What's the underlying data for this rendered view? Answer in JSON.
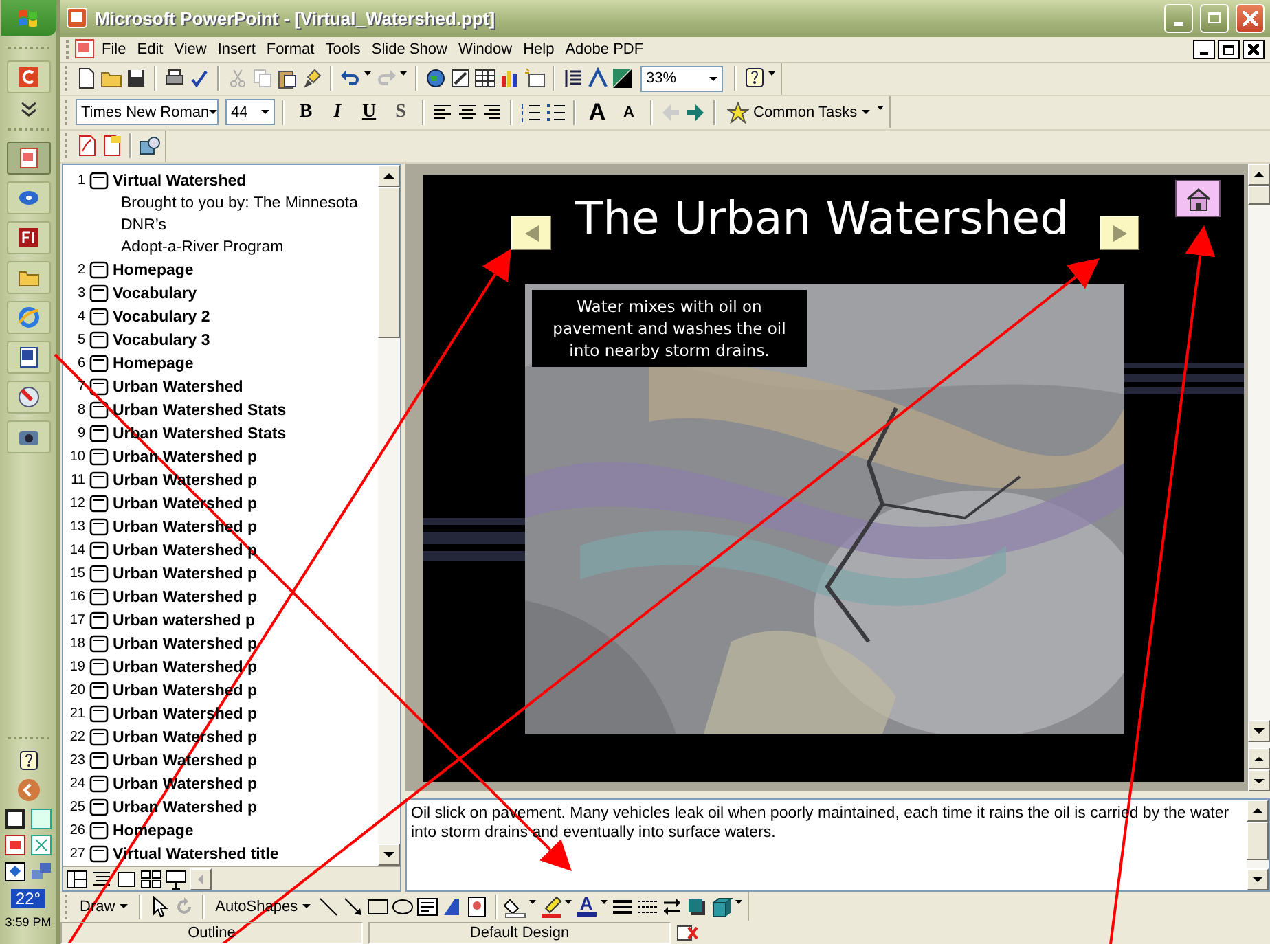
{
  "taskbar": {
    "weather": "22°",
    "clock": "3:59 PM"
  },
  "window": {
    "title": "Microsoft PowerPoint - [Virtual_Watershed.ppt]"
  },
  "menu": [
    "File",
    "Edit",
    "View",
    "Insert",
    "Format",
    "Tools",
    "Slide Show",
    "Window",
    "Help",
    "Adobe PDF"
  ],
  "standard_toolbar": {
    "zoom": "33%"
  },
  "formatting_toolbar": {
    "font": "Times New Roman",
    "size": "44",
    "style_buttons": [
      "B",
      "I",
      "U",
      "S"
    ],
    "size_buttons": [
      "A",
      "A"
    ],
    "common_tasks": "Common Tasks"
  },
  "outline": [
    {
      "number": "1",
      "title": "Virtual Watershed",
      "body": [
        "Brought to you by: The Minnesota",
        "DNR’s",
        "Adopt-a-River Program"
      ]
    },
    {
      "number": "2",
      "title": "Homepage"
    },
    {
      "number": "3",
      "title": "Vocabulary"
    },
    {
      "number": "4",
      "title": "Vocabulary 2"
    },
    {
      "number": "5",
      "title": "Vocabulary 3"
    },
    {
      "number": "6",
      "title": "Homepage"
    },
    {
      "number": "7",
      "title": "Urban Watershed"
    },
    {
      "number": "8",
      "title": "Urban Watershed Stats"
    },
    {
      "number": "9",
      "title": "Urban Watershed Stats"
    },
    {
      "number": "10",
      "title": "Urban Watershed p"
    },
    {
      "number": "11",
      "title": "Urban Watershed p"
    },
    {
      "number": "12",
      "title": "Urban Watershed p"
    },
    {
      "number": "13",
      "title": "Urban Watershed p"
    },
    {
      "number": "14",
      "title": "Urban Watershed p"
    },
    {
      "number": "15",
      "title": "Urban Watershed p"
    },
    {
      "number": "16",
      "title": "Urban Watershed p"
    },
    {
      "number": "17",
      "title": "Urban watershed p"
    },
    {
      "number": "18",
      "title": "Urban Watershed p"
    },
    {
      "number": "19",
      "title": "Urban Watershed p"
    },
    {
      "number": "20",
      "title": "Urban Watershed p"
    },
    {
      "number": "21",
      "title": "Urban Watershed p"
    },
    {
      "number": "22",
      "title": "Urban Watershed p"
    },
    {
      "number": "23",
      "title": "Urban Watershed p"
    },
    {
      "number": "24",
      "title": "Urban Watershed p"
    },
    {
      "number": "25",
      "title": "Urban Watershed p"
    },
    {
      "number": "26",
      "title": "Homepage"
    },
    {
      "number": "27",
      "title": "Virtual Watershed title"
    }
  ],
  "slide": {
    "title": "The Urban Watershed",
    "caption": "Water mixes with oil on pavement and washes the oil into nearby storm drains."
  },
  "notes": "Oil slick on pavement. Many vehicles leak oil when poorly maintained, each time it rains the oil is carried by the water into storm drains and eventually into surface waters.",
  "drawing_toolbar": {
    "draw": "Draw",
    "autoshapes": "AutoShapes",
    "font_color": "A"
  },
  "status_bar": [
    "Outline",
    "Default Design"
  ]
}
